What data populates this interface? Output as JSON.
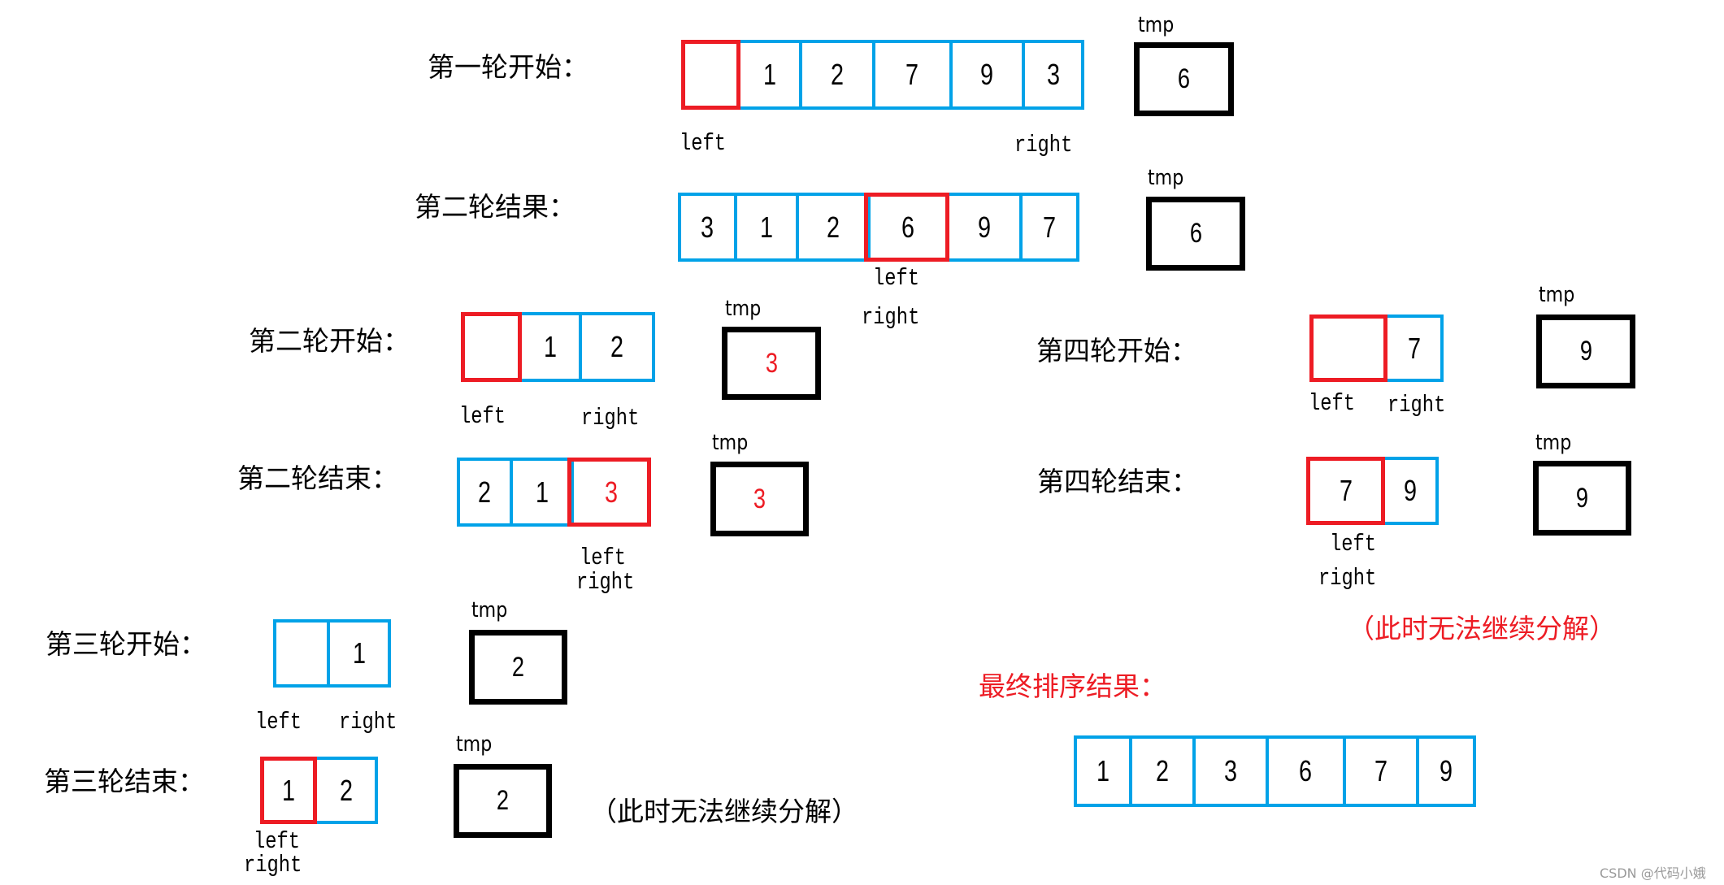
{
  "colors": {
    "array_border": "#00a2e8",
    "highlight": "#ed1c24",
    "tmp_border": "#000000",
    "watermark": "#9a9a9a"
  },
  "steps": [
    {
      "label": "第一轮开始：",
      "cells": [
        {
          "value": "",
          "highlight": true
        },
        {
          "value": "1"
        },
        {
          "value": "2"
        },
        {
          "value": "7"
        },
        {
          "value": "9"
        },
        {
          "value": "3"
        }
      ],
      "tmp_label": "tmp",
      "tmp_value": "6",
      "tmp_value_red": false,
      "pointers": [
        "left",
        "right"
      ]
    },
    {
      "label": "第二轮结果：",
      "cells": [
        {
          "value": "3"
        },
        {
          "value": "1"
        },
        {
          "value": "2"
        },
        {
          "value": "6",
          "highlight": true
        },
        {
          "value": "9"
        },
        {
          "value": "7"
        }
      ],
      "tmp_label": "tmp",
      "tmp_value": "6",
      "tmp_value_red": false,
      "pointers": [
        "left",
        "right"
      ]
    },
    {
      "label": "第二轮开始：",
      "cells": [
        {
          "value": "",
          "highlight": true
        },
        {
          "value": "1"
        },
        {
          "value": "2"
        }
      ],
      "tmp_label": "tmp",
      "tmp_value": "3",
      "tmp_value_red": true,
      "pointers": [
        "left",
        "right"
      ]
    },
    {
      "label": "第二轮结束：",
      "cells": [
        {
          "value": "2"
        },
        {
          "value": "1"
        },
        {
          "value": "3",
          "highlight": true,
          "red": true
        }
      ],
      "tmp_label": "tmp",
      "tmp_value": "3",
      "tmp_value_red": true,
      "pointers": [
        "left",
        "right"
      ]
    },
    {
      "label": "第三轮开始：",
      "cells": [
        {
          "value": ""
        },
        {
          "value": "1"
        }
      ],
      "tmp_label": "tmp",
      "tmp_value": "2",
      "tmp_value_red": false,
      "pointers": [
        "left",
        "right"
      ]
    },
    {
      "label": "第三轮结束：",
      "cells": [
        {
          "value": "1",
          "highlight": true
        },
        {
          "value": "2"
        }
      ],
      "tmp_label": "tmp",
      "tmp_value": "2",
      "tmp_value_red": false,
      "pointers": [
        "left",
        "right"
      ],
      "note": "（此时无法继续分解）"
    },
    {
      "label": "第四轮开始：",
      "cells": [
        {
          "value": "",
          "highlight": true
        },
        {
          "value": "7"
        }
      ],
      "tmp_label": "tmp",
      "tmp_value": "9",
      "tmp_value_red": false,
      "pointers": [
        "left",
        "right"
      ]
    },
    {
      "label": "第四轮结束：",
      "cells": [
        {
          "value": "7",
          "highlight": true
        },
        {
          "value": "9"
        }
      ],
      "tmp_label": "tmp",
      "tmp_value": "9",
      "tmp_value_red": false,
      "pointers": [
        "left",
        "right"
      ],
      "note": "（此时无法继续分解）"
    }
  ],
  "final": {
    "label": "最终排序结果：",
    "cells": [
      "1",
      "2",
      "3",
      "6",
      "7",
      "9"
    ]
  },
  "watermark": "CSDN @代码小娥"
}
